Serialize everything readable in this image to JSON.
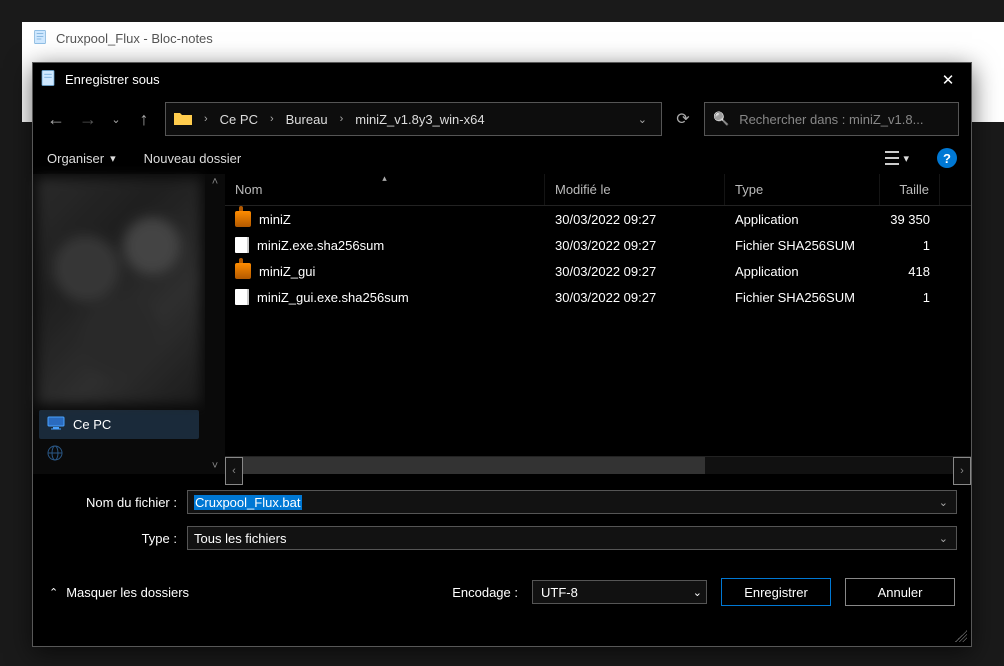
{
  "parent_window": {
    "title": "Cruxpool_Flux - Bloc-notes"
  },
  "dialog": {
    "title": "Enregistrer sous",
    "close_glyph": "✕"
  },
  "nav": {
    "back_glyph": "←",
    "fwd_glyph": "→",
    "recent_glyph": "⌄",
    "up_glyph": "↑",
    "refresh_glyph": "⟳",
    "address_dd_glyph": "⌄"
  },
  "breadcrumbs": [
    {
      "label": "Ce PC"
    },
    {
      "label": "Bureau"
    },
    {
      "label": "miniZ_v1.8y3_win-x64"
    }
  ],
  "search": {
    "icon": "🔍",
    "placeholder": "Rechercher dans : miniZ_v1.8..."
  },
  "toolbar": {
    "organize": "Organiser",
    "new_folder": "Nouveau dossier",
    "dd_glyph": "▾",
    "help_glyph": "?"
  },
  "columns": {
    "name": "Nom",
    "modified": "Modifié le",
    "type": "Type",
    "size": "Taille"
  },
  "files": [
    {
      "name": "miniZ",
      "modified": "30/03/2022 09:27",
      "type": "Application",
      "size": "39 350",
      "icon": "app"
    },
    {
      "name": "miniZ.exe.sha256sum",
      "modified": "30/03/2022 09:27",
      "type": "Fichier SHA256SUM",
      "size": "1",
      "icon": "file"
    },
    {
      "name": "miniZ_gui",
      "modified": "30/03/2022 09:27",
      "type": "Application",
      "size": "418",
      "icon": "app"
    },
    {
      "name": "miniZ_gui.exe.sha256sum",
      "modified": "30/03/2022 09:27",
      "type": "Fichier SHA256SUM",
      "size": "1",
      "icon": "file"
    }
  ],
  "sidebar": {
    "ce_pc": "Ce PC"
  },
  "form": {
    "filename_label": "Nom du fichier :",
    "filename_value": "Cruxpool_Flux.bat",
    "type_label": "Type :",
    "type_value": "Tous les fichiers",
    "dd_glyph": "⌄"
  },
  "footer": {
    "toggle_label": "Masquer les dossiers",
    "toggle_glyph": "⌃",
    "encoding_label": "Encodage :",
    "encoding_value": "UTF-8",
    "dd_glyph": "⌄",
    "save": "Enregistrer",
    "cancel": "Annuler"
  }
}
